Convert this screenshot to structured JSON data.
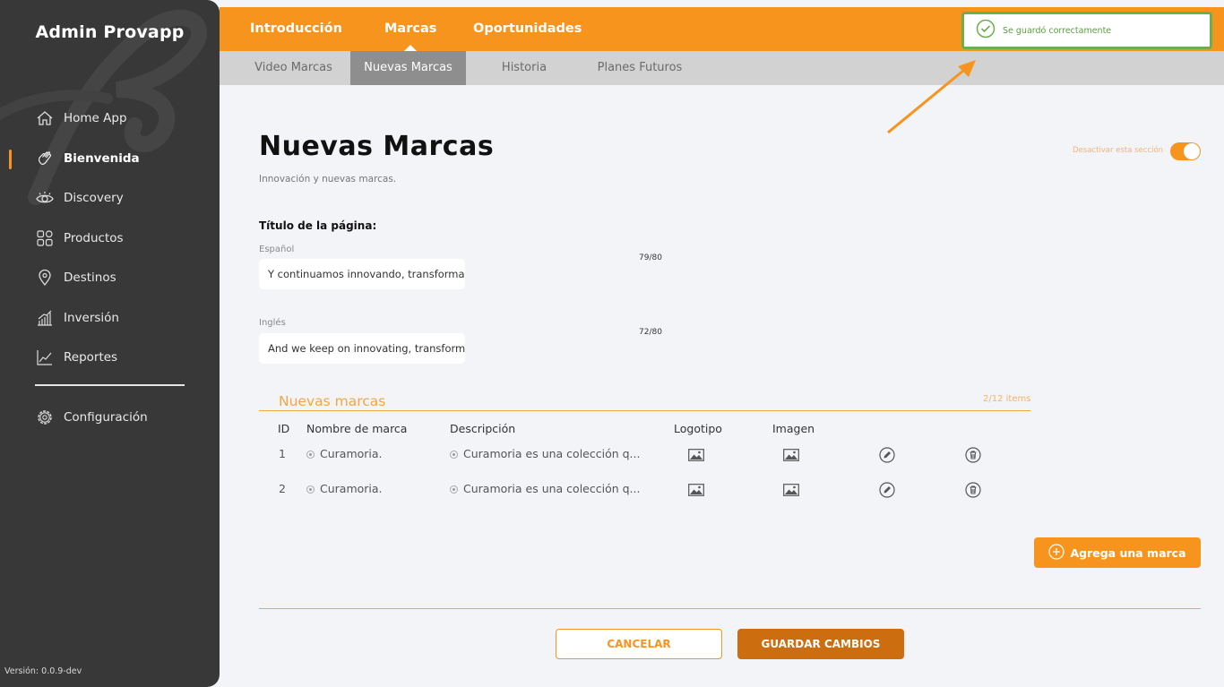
{
  "app": {
    "brand": "Admin Provapp",
    "version": "Versión: 0.0.9-dev"
  },
  "sidebar": {
    "items": [
      {
        "label": "Home App",
        "icon": "home-icon"
      },
      {
        "label": "Bienvenida",
        "icon": "waving-hand-icon",
        "active": true
      },
      {
        "label": "Discovery",
        "icon": "eye-icon"
      },
      {
        "label": "Productos",
        "icon": "grid-shapes-icon"
      },
      {
        "label": "Destinos",
        "icon": "location-pin-icon"
      },
      {
        "label": "Inversión",
        "icon": "bar-chart-icon"
      },
      {
        "label": "Reportes",
        "icon": "line-chart-icon"
      }
    ],
    "settings": {
      "label": "Configuración",
      "icon": "gear-icon"
    }
  },
  "topnav": {
    "tabs": [
      "Introducción",
      "Marcas",
      "Oportunidades"
    ],
    "active": "Marcas"
  },
  "subnav": {
    "tabs": [
      "Video Marcas",
      "Nuevas Marcas",
      "Historia",
      "Planes Futuros"
    ],
    "active": "Nuevas Marcas"
  },
  "toast": {
    "message": "Se guardó correctamente",
    "icon": "check-circle-icon"
  },
  "page": {
    "title": "Nuevas Marcas",
    "subtitle": "Innovación y nuevas marcas.",
    "toggle_label": "Desactivar esta sección",
    "toggle_on": true
  },
  "form": {
    "section_label": "Título de la página:",
    "spanish": {
      "label": "Español",
      "value": "Y continuamos innovando, transformar",
      "counter": "79/80"
    },
    "english": {
      "label": "Inglés",
      "value": "And we keep on innovating, transformi",
      "counter": "72/80"
    }
  },
  "brands": {
    "title": "Nuevas marcas",
    "count": "2/12 items",
    "headers": {
      "id": "ID",
      "name": "Nombre de marca",
      "description": "Descripción",
      "logo": "Logotipo",
      "image": "Imagen"
    },
    "rows": [
      {
        "id": "1",
        "name": "Curamoria.",
        "description": "Curamoria es una colección q..."
      },
      {
        "id": "2",
        "name": "Curamoria.",
        "description": "Curamoria es una colección q..."
      }
    ],
    "add_label": "Agrega una marca"
  },
  "actions": {
    "cancel": "CANCELAR",
    "save": "GUARDAR CAMBIOS"
  },
  "colors": {
    "accent": "#f7941d",
    "sidebar": "#383838",
    "success": "#6ab04c",
    "save": "#cc6d0f"
  }
}
